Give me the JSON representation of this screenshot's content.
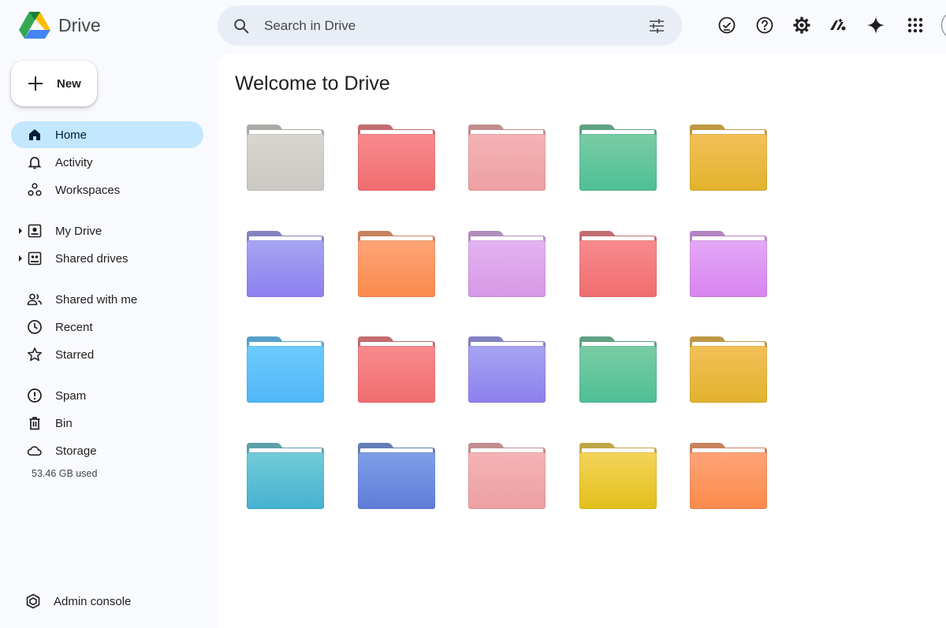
{
  "app": {
    "name": "Drive"
  },
  "search": {
    "placeholder": "Search in Drive"
  },
  "top_icons": [
    "offline-ready-icon",
    "help-icon",
    "settings-icon",
    "gemini-alt-icon",
    "sparkle-icon",
    "apps-grid-icon"
  ],
  "new_button": {
    "label": "New"
  },
  "nav": [
    {
      "id": "home",
      "label": "Home",
      "icon": "home-icon",
      "active": true
    },
    {
      "id": "activity",
      "label": "Activity",
      "icon": "bell-icon"
    },
    {
      "id": "workspaces",
      "label": "Workspaces",
      "icon": "workspaces-icon"
    },
    {
      "id": "my-drive",
      "label": "My Drive",
      "icon": "drive-icon",
      "expandable": true
    },
    {
      "id": "shared-drives",
      "label": "Shared drives",
      "icon": "shared-drives-icon",
      "expandable": true
    },
    {
      "id": "shared-with-me",
      "label": "Shared with me",
      "icon": "people-icon"
    },
    {
      "id": "recent",
      "label": "Recent",
      "icon": "clock-icon"
    },
    {
      "id": "starred",
      "label": "Starred",
      "icon": "star-icon"
    },
    {
      "id": "spam",
      "label": "Spam",
      "icon": "spam-icon"
    },
    {
      "id": "bin",
      "label": "Bin",
      "icon": "trash-icon"
    },
    {
      "id": "storage",
      "label": "Storage",
      "icon": "cloud-icon"
    }
  ],
  "storage": {
    "used": "53.46 GB used"
  },
  "admin": {
    "label": "Admin console"
  },
  "main": {
    "title": "Welcome to Drive"
  },
  "folder_rows": [
    [
      [
        "#d9d6d1",
        "#cbc8c3"
      ],
      [
        "#f88a8e",
        "#f06d70"
      ],
      [
        "#f4b3b5",
        "#eda0a2"
      ],
      [
        "#79cca5",
        "#4fbf95"
      ],
      [
        "#f2c058",
        "#e2b22c"
      ]
    ],
    [
      [
        "#a7a4f3",
        "#8d7fee"
      ],
      [
        "#fea477",
        "#fb8a4c"
      ],
      [
        "#e2b3f1",
        "#d898e6"
      ],
      [
        "#f88a8e",
        "#f06d70"
      ],
      [
        "#e4a8f6",
        "#d884f0"
      ]
    ],
    [
      [
        "#6ccbfd",
        "#51b7f8"
      ],
      [
        "#f88a8e",
        "#f06d70"
      ],
      [
        "#a7a4f3",
        "#8d7fee"
      ],
      [
        "#79cca5",
        "#4fbf95"
      ],
      [
        "#f2c058",
        "#e2b22c"
      ]
    ],
    [
      [
        "#73cbd8",
        "#45b2d0"
      ],
      [
        "#7e9fe7",
        "#5f7cd8"
      ],
      [
        "#f4b3b5",
        "#eda0a2"
      ],
      [
        "#f4d35a",
        "#e2c01a"
      ],
      [
        "#fea477",
        "#fb8a4c"
      ]
    ]
  ]
}
